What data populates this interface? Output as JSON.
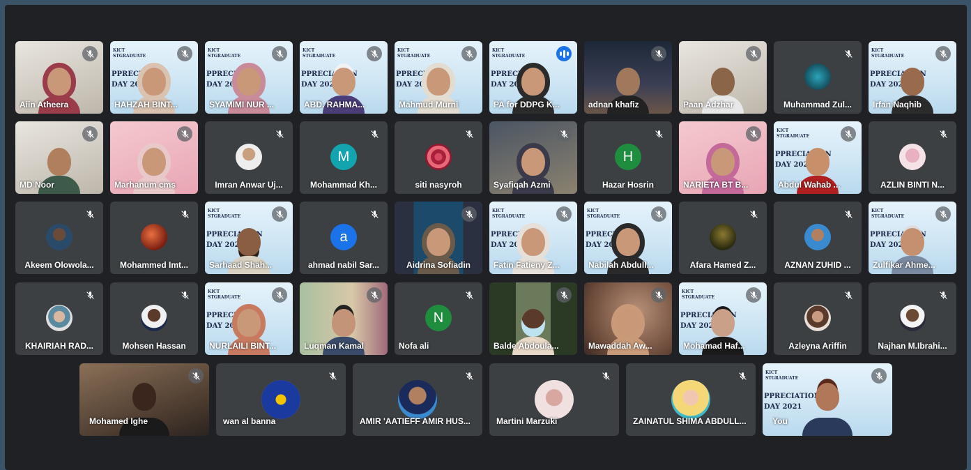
{
  "participants_rows": [
    [
      {
        "name": "Aiin Atheera",
        "mute": true
      },
      {
        "name": "HAHZAH BINT...",
        "mute": true
      },
      {
        "name": "SYAMIMI NUR ...",
        "mute": true
      },
      {
        "name": "ABD. RAHMA...",
        "mute": true
      },
      {
        "name": "Mahmud Murni",
        "mute": true
      },
      {
        "name": "PA for DDPG K...",
        "mute": false,
        "speaking": true
      },
      {
        "name": "adnan khafiz",
        "mute": true
      },
      {
        "name": "Paan Adzhar",
        "mute": true
      },
      {
        "name": "Muhammad Zul...",
        "mute": true
      },
      {
        "name": "Irfan Naqhib",
        "mute": true
      }
    ],
    [
      {
        "name": "MD Noor",
        "mute": true
      },
      {
        "name": "Marhanum cms",
        "mute": true
      },
      {
        "name": "Imran Anwar Uj...",
        "mute": true
      },
      {
        "name": "Mohammad Kh...",
        "mute": true,
        "initial": "M"
      },
      {
        "name": "siti nasyroh",
        "mute": true
      },
      {
        "name": "Syafiqah Azmi",
        "mute": true
      },
      {
        "name": "Hazar Hosrin",
        "mute": true,
        "initial": "H"
      },
      {
        "name": "NARIETA BT B...",
        "mute": true
      },
      {
        "name": "Abdul Wahab ...",
        "mute": true
      },
      {
        "name": "AZLIN BINTI N...",
        "mute": true
      }
    ],
    [
      {
        "name": "Akeem Olowola...",
        "mute": true
      },
      {
        "name": "Mohammed Imt...",
        "mute": true
      },
      {
        "name": "Sarhaad Shah...",
        "mute": true
      },
      {
        "name": "ahmad nabil Sar...",
        "mute": true,
        "initial": "a"
      },
      {
        "name": "Aidrina Sofiadin",
        "mute": true
      },
      {
        "name": "Fatin Fatieny Z...",
        "mute": true
      },
      {
        "name": "Nabilah Abdull...",
        "mute": true
      },
      {
        "name": "Afara Hamed Z...",
        "mute": true
      },
      {
        "name": "AZNAN ZUHID ...",
        "mute": true
      },
      {
        "name": "Zulfikar Ahme...",
        "mute": true
      }
    ],
    [
      {
        "name": "KHAIRIAH RAD...",
        "mute": true
      },
      {
        "name": "Mohsen Hassan",
        "mute": true
      },
      {
        "name": "NURLAILI BINT...",
        "mute": true
      },
      {
        "name": "Luqman Kamal",
        "mute": true
      },
      {
        "name": "Nofa ali",
        "mute": true,
        "initial": "N"
      },
      {
        "name": "Balde Abdoula...",
        "mute": true
      },
      {
        "name": "Mawaddah Aw...",
        "mute": true
      },
      {
        "name": "Mohamad Haf...",
        "mute": true
      },
      {
        "name": "Azleyna Ariffin",
        "mute": true
      },
      {
        "name": "Najhan M.Ibrahi...",
        "mute": true
      }
    ],
    [
      {
        "name": "Mohamed Ighe",
        "mute": true
      },
      {
        "name": "wan al banna",
        "mute": true
      },
      {
        "name": "AMIR 'AATIEFF AMIR HUS...",
        "mute": true
      },
      {
        "name": "Martini Marzuki",
        "mute": true
      },
      {
        "name": "ZAINATUL SHIMA ABDULL...",
        "mute": true
      },
      {
        "name": "You",
        "mute": true
      }
    ]
  ],
  "colors": {
    "outer_background": "#3a5366",
    "meet_background": "#202124",
    "tile_background": "#3c4043",
    "speaking_indicator": "#1a73e8",
    "initial_teal": "#12a4af",
    "initial_blue": "#1a73e8",
    "initial_green": "#1e8e3e"
  },
  "icons": {
    "mute": "mic-off-icon",
    "speaking": "audio-level-icon"
  }
}
